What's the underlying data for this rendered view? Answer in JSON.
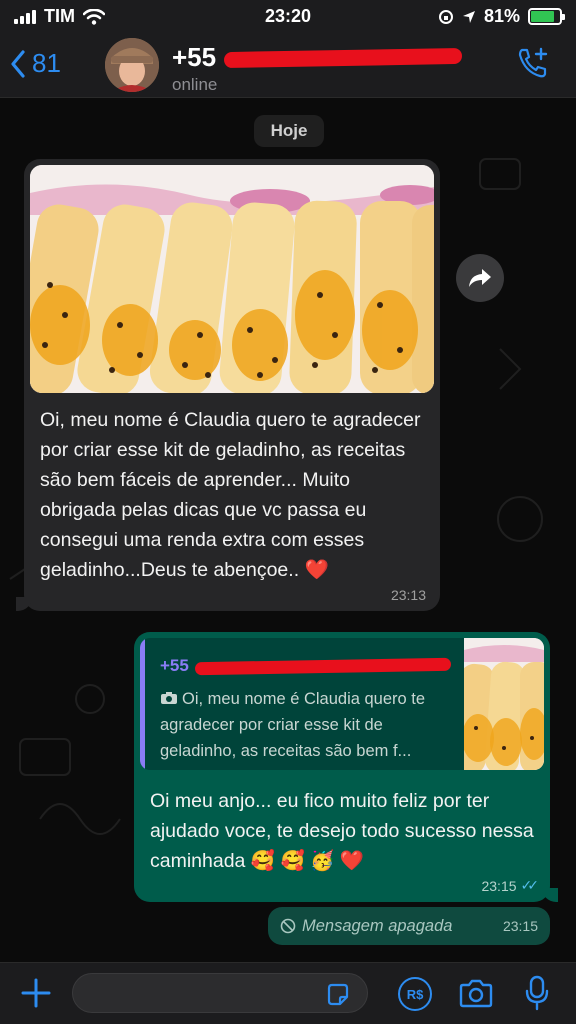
{
  "status_bar": {
    "carrier": "TIM",
    "time": "23:20",
    "battery": "81%",
    "battery_level": 0.81
  },
  "header": {
    "back_count": "81",
    "contact_name": "+55",
    "presence": "online"
  },
  "chat": {
    "day_label": "Hoje",
    "incoming": {
      "text": "Oi, meu nome é Claudia quero te agradecer por criar esse kit de geladinho, as receitas são bem fáceis de aprender... Muito obrigada pelas dicas que vc passa eu consegui uma renda extra com esses geladinho...Deus te abençoe.. ❤️",
      "time": "23:13"
    },
    "outgoing": {
      "quote_name": "+55",
      "quote_text": "Oi, meu nome é Claudia quero te agradecer por criar esse kit de geladinho, as receitas são bem f...",
      "text": "Oi meu anjo... eu fico muito feliz por ter ajudado voce, te desejo todo sucesso nessa caminhada 🥰 🥰 🥳 ❤️",
      "time": "23:15"
    },
    "deleted": {
      "text": "Mensagem apagada",
      "time": "23:15"
    }
  },
  "input_bar": {
    "pay_label": "R$"
  },
  "colors": {
    "accent": "#2d8cf0",
    "outgoing_bubble": "#005c4b",
    "incoming_bubble": "#262628",
    "quote_name": "#8a7cf5",
    "redaction": "#e8101c"
  }
}
